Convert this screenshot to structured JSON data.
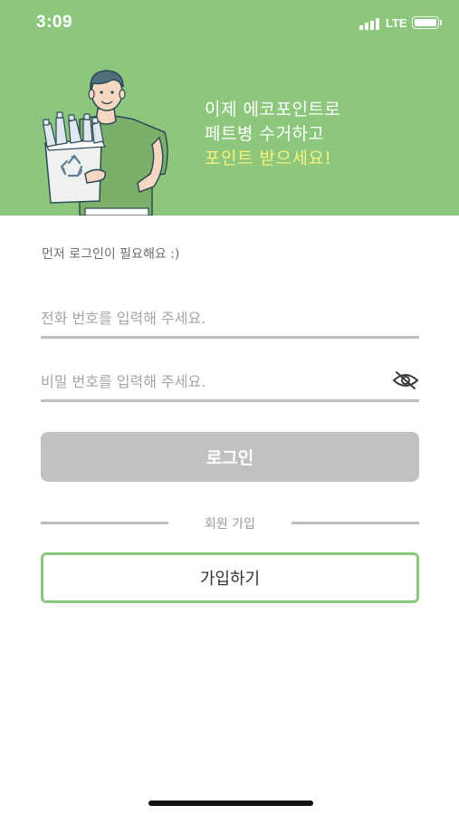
{
  "status_bar": {
    "time": "3:09",
    "network": "LTE",
    "battery_icon": "battery-icon",
    "signal_icon": "signal-icon"
  },
  "hero": {
    "background": "#8cc77d",
    "headline_line1": "이제 에코포인트로",
    "headline_line2": "페트병 수거하고",
    "headline_line3": "포인트 받으세요!",
    "highlight_color": "#f7f27a"
  },
  "login": {
    "hint": "먼저 로그인이 필요해요 :)",
    "phone_placeholder": "전화 번호를 입력해 주세요.",
    "phone_value": "",
    "password_placeholder": "비밀 번호를 입력해 주세요.",
    "password_value": "",
    "toggle_icon": "eye-off-icon",
    "login_label": "로그인"
  },
  "signup": {
    "divider_label": "회원 가입",
    "button_label": "가입하기",
    "accent": "#8cc77d"
  }
}
